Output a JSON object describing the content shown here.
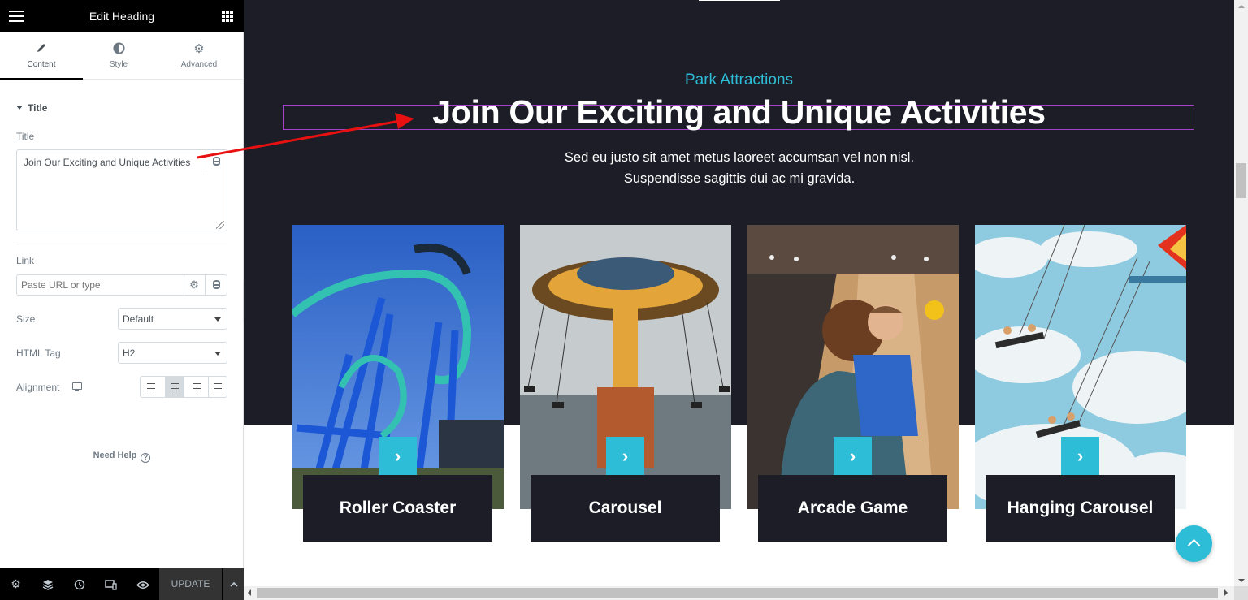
{
  "panel": {
    "title": "Edit Heading",
    "tabs": [
      {
        "label": "Content",
        "icon": "pencil-icon"
      },
      {
        "label": "Style",
        "icon": "half-circle-icon"
      },
      {
        "label": "Advanced",
        "icon": "gear-icon"
      }
    ],
    "section_label": "Title",
    "title_label": "Title",
    "title_value": "Join Our Exciting and Unique Activities",
    "link_label": "Link",
    "link_placeholder": "Paste URL or type",
    "size_label": "Size",
    "size_value": "Default",
    "html_tag_label": "HTML Tag",
    "html_tag_value": "H2",
    "alignment_label": "Alignment",
    "alignment_selected": "center",
    "need_help": "Need Help",
    "update_label": "UPDATE"
  },
  "preview": {
    "eyebrow": "Park Attractions",
    "heading": "Join Our Exciting and Unique Activities",
    "description": "Sed eu justo sit amet metus laoreet accumsan vel non nisl. Suspendisse sagittis dui ac mi gravida.",
    "cards": [
      {
        "title": "Roller Coaster"
      },
      {
        "title": "Carousel"
      },
      {
        "title": "Arcade Game"
      },
      {
        "title": "Hanging Carousel"
      }
    ]
  },
  "colors": {
    "accent": "#2ebdd6",
    "dark_bg": "#1c1d27",
    "selection_outline": "#a142c9",
    "annotation_arrow": "#e81010"
  }
}
